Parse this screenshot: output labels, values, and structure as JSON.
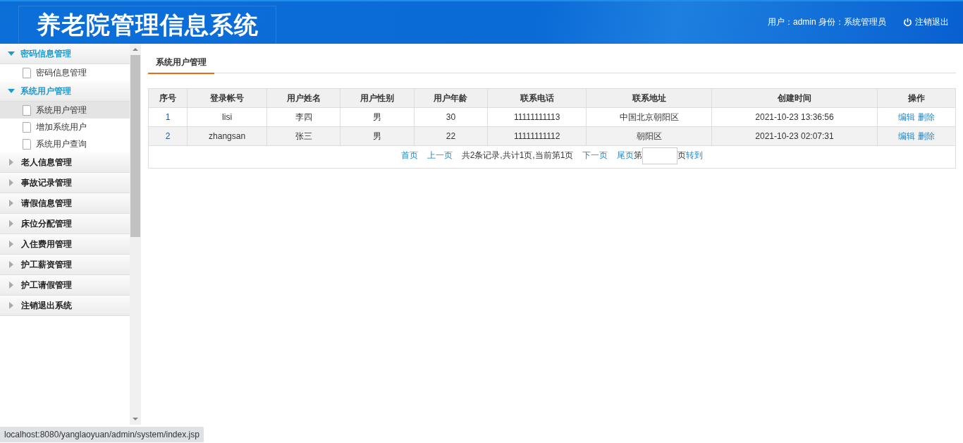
{
  "header": {
    "title": "养老院管理信息系统",
    "user_info": "用户：admin 身份：系统管理员",
    "logout": "注销退出"
  },
  "sidebar": {
    "groups": [
      {
        "label": "密码信息管理",
        "expanded": true,
        "items": [
          {
            "label": "密码信息管理",
            "selected": false
          }
        ]
      },
      {
        "label": "系统用户管理",
        "expanded": true,
        "items": [
          {
            "label": "系统用户管理",
            "selected": true
          },
          {
            "label": "增加系统用户",
            "selected": false
          },
          {
            "label": "系统用户查询",
            "selected": false
          }
        ]
      },
      {
        "label": "老人信息管理",
        "expanded": false
      },
      {
        "label": "事故记录管理",
        "expanded": false
      },
      {
        "label": "请假信息管理",
        "expanded": false
      },
      {
        "label": "床位分配管理",
        "expanded": false
      },
      {
        "label": "入住费用管理",
        "expanded": false
      },
      {
        "label": "护工薪资管理",
        "expanded": false
      },
      {
        "label": "护工请假管理",
        "expanded": false
      },
      {
        "label": "注销退出系统",
        "expanded": false
      }
    ]
  },
  "tabs": [
    {
      "label": "系统用户管理",
      "selected": true
    }
  ],
  "table": {
    "columns": [
      "序号",
      "登录帐号",
      "用户姓名",
      "用户性别",
      "用户年龄",
      "联系电话",
      "联系地址",
      "创建时间",
      "操作"
    ],
    "rows": [
      {
        "cells": [
          "1",
          "lisi",
          "李四",
          "男",
          "30",
          "11111111113",
          "中国北京朝阳区",
          "2021-10-23 13:36:56"
        ],
        "actions": [
          "编辑",
          "删除"
        ]
      },
      {
        "cells": [
          "2",
          "zhangsan",
          "张三",
          "男",
          "22",
          "11111111112",
          "朝阳区",
          "2021-10-23 02:07:31"
        ],
        "actions": [
          "编辑",
          "删除"
        ]
      }
    ]
  },
  "pager": {
    "first": "首页",
    "prev": "上一页",
    "summary": "共2条记录,共计1页,当前第1页",
    "next": "下一页",
    "last": "尾页",
    "page_prefix": "第",
    "page_suffix": "页",
    "go": "转到"
  },
  "status_bar": "localhost:8080/yanglaoyuan/admin/system/index.jsp"
}
